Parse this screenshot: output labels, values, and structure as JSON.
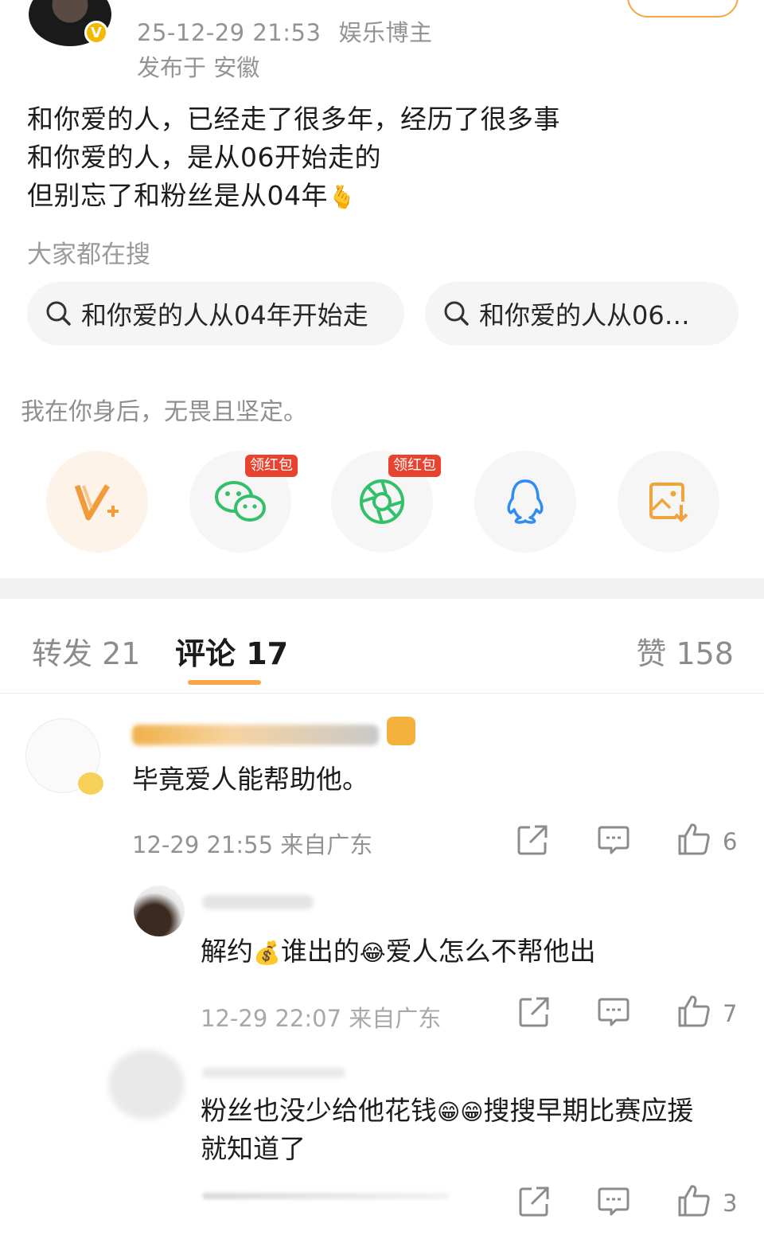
{
  "header": {
    "timestamp": "25-12-29 21:53",
    "author_tag": "娱乐博主",
    "location": "发布于 安徽"
  },
  "post": {
    "lines": [
      "和你爱的人，已经走了很多年，经历了很多事",
      "和你爱的人，是从06开始走的",
      "但别忘了和粉丝是从04年"
    ],
    "line3_emoji": "🫰"
  },
  "search": {
    "label": "大家都在搜",
    "chips": [
      "和你爱的人从04年开始走",
      "和你爱的人从06…"
    ]
  },
  "signature": "我在你身后，无畏且坚定。",
  "share": {
    "redpack_label": "领红包",
    "icons": [
      "v-plus-icon",
      "wechat-icon",
      "moments-icon",
      "qq-icon",
      "save-image-icon"
    ]
  },
  "tabs": {
    "repost": "转发 21",
    "comments": "评论 17",
    "likes": "赞 158"
  },
  "comments": [
    {
      "text": "毕竟爱人能帮助他。",
      "meta": "12-29 21:55  来自广东",
      "likes": "6"
    },
    {
      "text_a": "解约",
      "emoji_a": "💰",
      "text_b": "谁出的",
      "emoji_b": "😂",
      "text_c": "爱人怎么不帮他出",
      "meta": "12-29 22:07  来自广东",
      "likes": "7"
    },
    {
      "text_a": "粉丝也没少给他花钱",
      "emoji_a": "😁😁",
      "text_b": "搜搜早期比赛应援",
      "text_line2": "就知道了",
      "likes": "3"
    }
  ],
  "colors": {
    "accent": "#f7a64a",
    "redpack": "#e8432f",
    "wechat": "#33c06a",
    "qq": "#2f8cf0",
    "gold": "#f5b800"
  }
}
